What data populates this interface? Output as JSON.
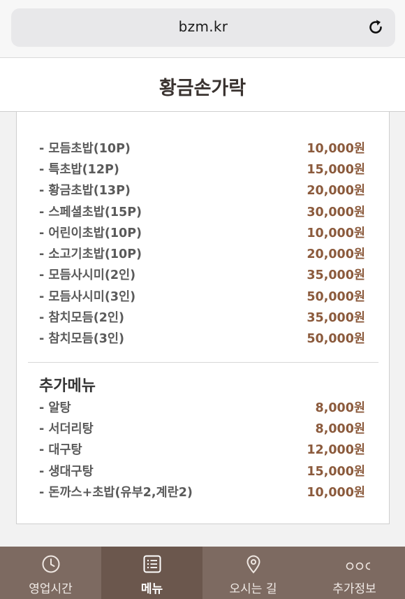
{
  "browser": {
    "url": "bzm.kr"
  },
  "header": {
    "title": "황금손가락"
  },
  "menu": {
    "items": [
      {
        "name": "- 모듬초밥(10P)",
        "price": "10,000원"
      },
      {
        "name": "- 특초밥(12P)",
        "price": "15,000원"
      },
      {
        "name": "- 황금초밥(13P)",
        "price": "20,000원"
      },
      {
        "name": "- 스페셜초밥(15P)",
        "price": "30,000원"
      },
      {
        "name": "- 어린이초밥(10P)",
        "price": "10,000원"
      },
      {
        "name": "- 소고기초밥(10P)",
        "price": "20,000원"
      },
      {
        "name": "- 모듬사시미(2인)",
        "price": "35,000원"
      },
      {
        "name": "- 모듬사시미(3인)",
        "price": "50,000원"
      },
      {
        "name": "- 참치모듬(2인)",
        "price": "35,000원"
      },
      {
        "name": "- 참치모듬(3인)",
        "price": "50,000원"
      }
    ],
    "extra_title": "추가메뉴",
    "extras": [
      {
        "name": "- 알탕",
        "price": "8,000원"
      },
      {
        "name": "- 서더리탕",
        "price": "8,000원"
      },
      {
        "name": "- 대구탕",
        "price": "12,000원"
      },
      {
        "name": "- 생대구탕",
        "price": "15,000원"
      },
      {
        "name": "- 돈까스+초밥(유부2,계란2)",
        "price": "10,000원"
      }
    ]
  },
  "tabs": [
    {
      "label": "영업시간",
      "icon": "clock-icon"
    },
    {
      "label": "메뉴",
      "icon": "list-icon",
      "active": true
    },
    {
      "label": "오시는 길",
      "icon": "location-pin-icon"
    },
    {
      "label": "추가정보",
      "icon": "more-dots-icon"
    }
  ],
  "colors": {
    "price": "#8b5a3c",
    "tab_bar": "#7d6a61",
    "tab_active": "#6b574d"
  }
}
